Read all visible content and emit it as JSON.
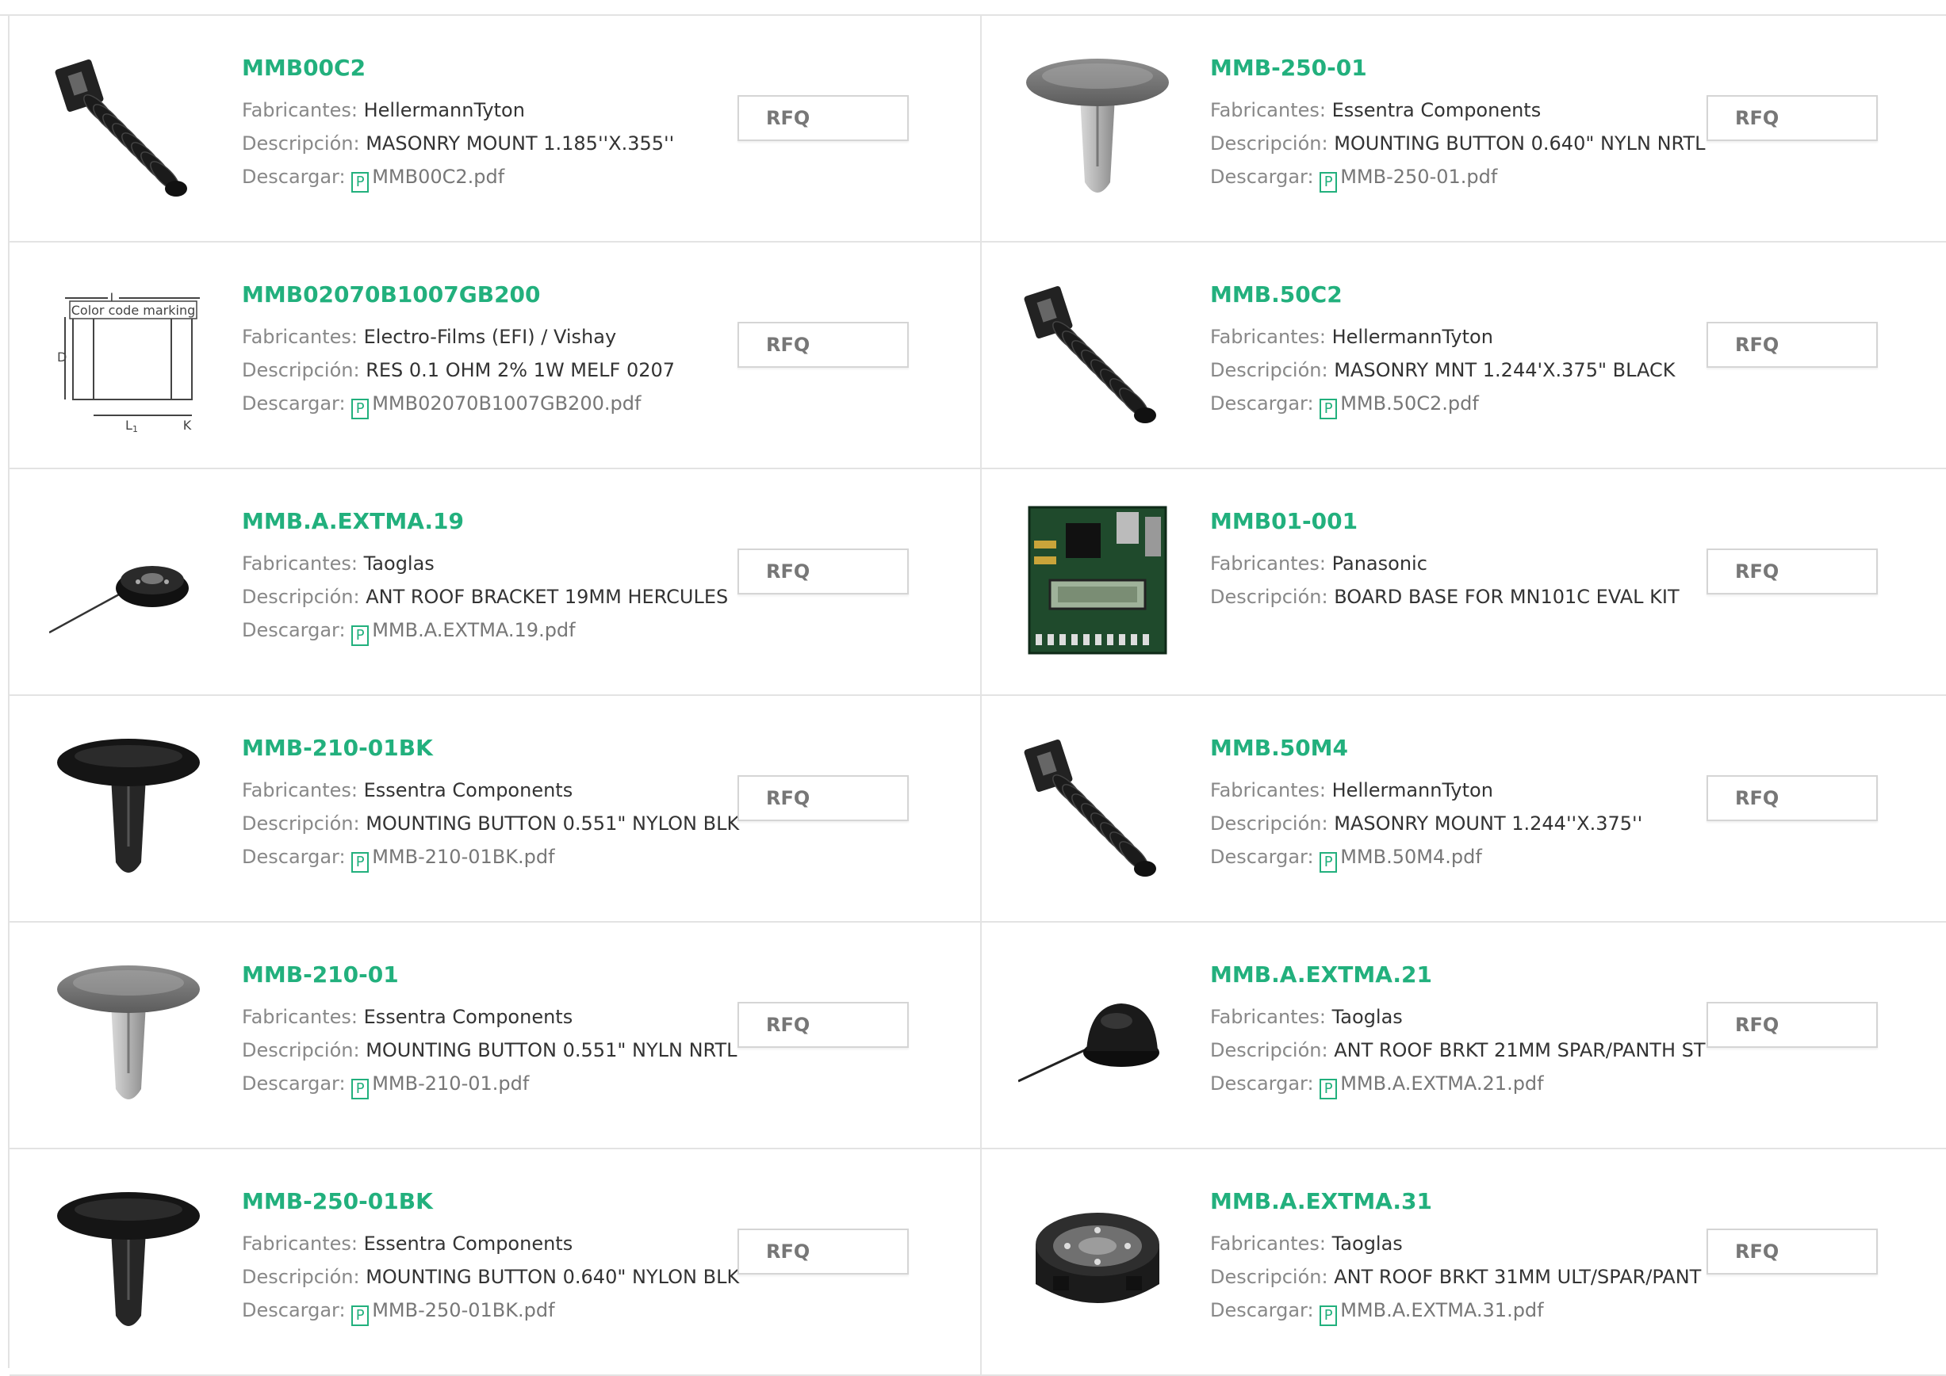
{
  "labels": {
    "manufacturer": "Fabricantes:",
    "description": "Descripción:",
    "download": "Descargar:",
    "rfq": "RFQ",
    "pdf_icon_letter": "P"
  },
  "colors": {
    "accent": "#22b07d",
    "border": "#e3e3e3",
    "label": "#888888"
  },
  "products": [
    {
      "part": "MMB00C2",
      "manufacturer": "HellermannTyton",
      "description": "MASONRY MOUNT 1.185''X.355''",
      "pdf": "MMB00C2.pdf",
      "image": "black-anchor-icon"
    },
    {
      "part": "MMB-250-01",
      "manufacturer": "Essentra Components",
      "description": "MOUNTING BUTTON 0.640\" NYLN NRTL",
      "pdf": "MMB-250-01.pdf",
      "image": "grey-button-icon"
    },
    {
      "part": "MMB02070B1007GB200",
      "manufacturer": "Electro-Films (EFI) / Vishay",
      "description": "RES 0.1 OHM 2% 1W MELF 0207",
      "pdf": "MMB02070B1007GB200.pdf",
      "image": "resistor-diagram-icon",
      "diagram_text": {
        "l": "L",
        "marking": "Color code marking",
        "d": "D",
        "l1": "L",
        "l1_sub": "1",
        "k": "K"
      }
    },
    {
      "part": "MMB.50C2",
      "manufacturer": "HellermannTyton",
      "description": "MASONRY MNT 1.244'X.375\" BLACK",
      "pdf": "MMB.50C2.pdf",
      "image": "black-anchor-icon"
    },
    {
      "part": "MMB.A.EXTMA.19",
      "manufacturer": "Taoglas",
      "description": "ANT ROOF BRACKET 19MM HERCULES",
      "pdf": "MMB.A.EXTMA.19.pdf",
      "image": "antenna-bracket-icon"
    },
    {
      "part": "MMB01-001",
      "manufacturer": "Panasonic",
      "description": "BOARD BASE FOR MN101C EVAL KIT",
      "pdf": null,
      "image": "eval-board-icon"
    },
    {
      "part": "MMB-210-01BK",
      "manufacturer": "Essentra Components",
      "description": "MOUNTING BUTTON 0.551\" NYLON BLK",
      "pdf": "MMB-210-01BK.pdf",
      "image": "black-button-icon"
    },
    {
      "part": "MMB.50M4",
      "manufacturer": "HellermannTyton",
      "description": "MASONRY MOUNT 1.244''X.375''",
      "pdf": "MMB.50M4.pdf",
      "image": "black-anchor-icon"
    },
    {
      "part": "MMB-210-01",
      "manufacturer": "Essentra Components",
      "description": "MOUNTING BUTTON 0.551\" NYLN NRTL",
      "pdf": "MMB-210-01.pdf",
      "image": "grey-button-icon"
    },
    {
      "part": "MMB.A.EXTMA.21",
      "manufacturer": "Taoglas",
      "description": "ANT ROOF BRKT 21MM SPAR/PANTH ST",
      "pdf": "MMB.A.EXTMA.21.pdf",
      "image": "antenna-dome-icon"
    },
    {
      "part": "MMB-250-01BK",
      "manufacturer": "Essentra Components",
      "description": "MOUNTING BUTTON 0.640\" NYLON BLK",
      "pdf": "MMB-250-01BK.pdf",
      "image": "black-button-icon"
    },
    {
      "part": "MMB.A.EXTMA.31",
      "manufacturer": "Taoglas",
      "description": "ANT ROOF BRKT 31MM ULT/SPAR/PANT",
      "pdf": "MMB.A.EXTMA.31.pdf",
      "image": "antenna-ring-icon"
    }
  ]
}
